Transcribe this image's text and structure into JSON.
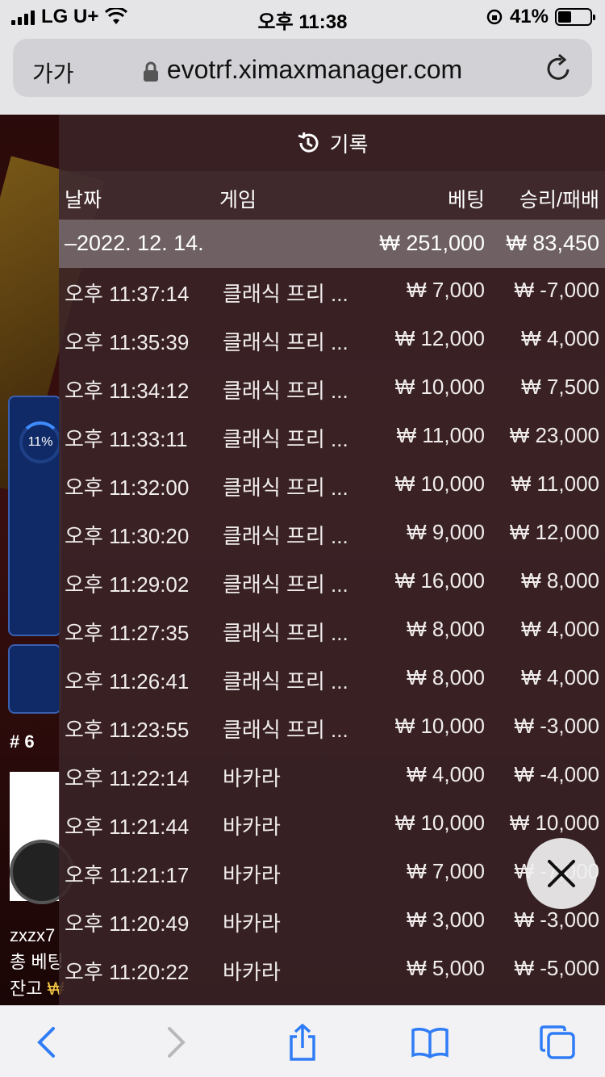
{
  "status": {
    "carrier": "LG U+",
    "time": "오후 11:38",
    "battery": "41%",
    "battery_level": 0.41
  },
  "browser": {
    "aa_label": "가가",
    "url": "evotrf.ximaxmanager.com"
  },
  "background": {
    "progress_pct": "11%",
    "rank": "# 6",
    "username": "zxzx7",
    "total_bet_label": "총 베팅",
    "balance_label": "잔고"
  },
  "history": {
    "title": "기록",
    "headers": {
      "date": "날짜",
      "game": "게임",
      "bet": "베팅",
      "win_loss": "승리/패배"
    },
    "date_group": {
      "date": "–2022. 12. 14.",
      "bet": "₩ 251,000",
      "win_loss": "₩ 83,450"
    },
    "rows": [
      {
        "time": "오후 11:37:14",
        "game": "클래식 프리 ...",
        "bet": "₩ 7,000",
        "win_loss": "₩ -7,000"
      },
      {
        "time": "오후 11:35:39",
        "game": "클래식 프리 ...",
        "bet": "₩ 12,000",
        "win_loss": "₩ 4,000"
      },
      {
        "time": "오후 11:34:12",
        "game": "클래식 프리 ...",
        "bet": "₩ 10,000",
        "win_loss": "₩ 7,500"
      },
      {
        "time": "오후 11:33:11",
        "game": "클래식 프리 ...",
        "bet": "₩ 11,000",
        "win_loss": "₩ 23,000"
      },
      {
        "time": "오후 11:32:00",
        "game": "클래식 프리 ...",
        "bet": "₩ 10,000",
        "win_loss": "₩ 11,000"
      },
      {
        "time": "오후 11:30:20",
        "game": "클래식 프리 ...",
        "bet": "₩ 9,000",
        "win_loss": "₩ 12,000"
      },
      {
        "time": "오후 11:29:02",
        "game": "클래식 프리 ...",
        "bet": "₩ 16,000",
        "win_loss": "₩ 8,000"
      },
      {
        "time": "오후 11:27:35",
        "game": "클래식 프리 ...",
        "bet": "₩ 8,000",
        "win_loss": "₩ 4,000"
      },
      {
        "time": "오후 11:26:41",
        "game": "클래식 프리 ...",
        "bet": "₩ 8,000",
        "win_loss": "₩ 4,000"
      },
      {
        "time": "오후 11:23:55",
        "game": "클래식 프리 ...",
        "bet": "₩ 10,000",
        "win_loss": "₩ -3,000"
      },
      {
        "time": "오후 11:22:14",
        "game": "바카라",
        "bet": "₩ 4,000",
        "win_loss": "₩ -4,000"
      },
      {
        "time": "오후 11:21:44",
        "game": "바카라",
        "bet": "₩ 10,000",
        "win_loss": "₩ 10,000"
      },
      {
        "time": "오후 11:21:17",
        "game": "바카라",
        "bet": "₩ 7,000",
        "win_loss": "₩ -7,000"
      },
      {
        "time": "오후 11:20:49",
        "game": "바카라",
        "bet": "₩ 3,000",
        "win_loss": "₩ -3,000"
      },
      {
        "time": "오후 11:20:22",
        "game": "바카라",
        "bet": "₩ 5,000",
        "win_loss": "₩ -5,000"
      }
    ]
  }
}
